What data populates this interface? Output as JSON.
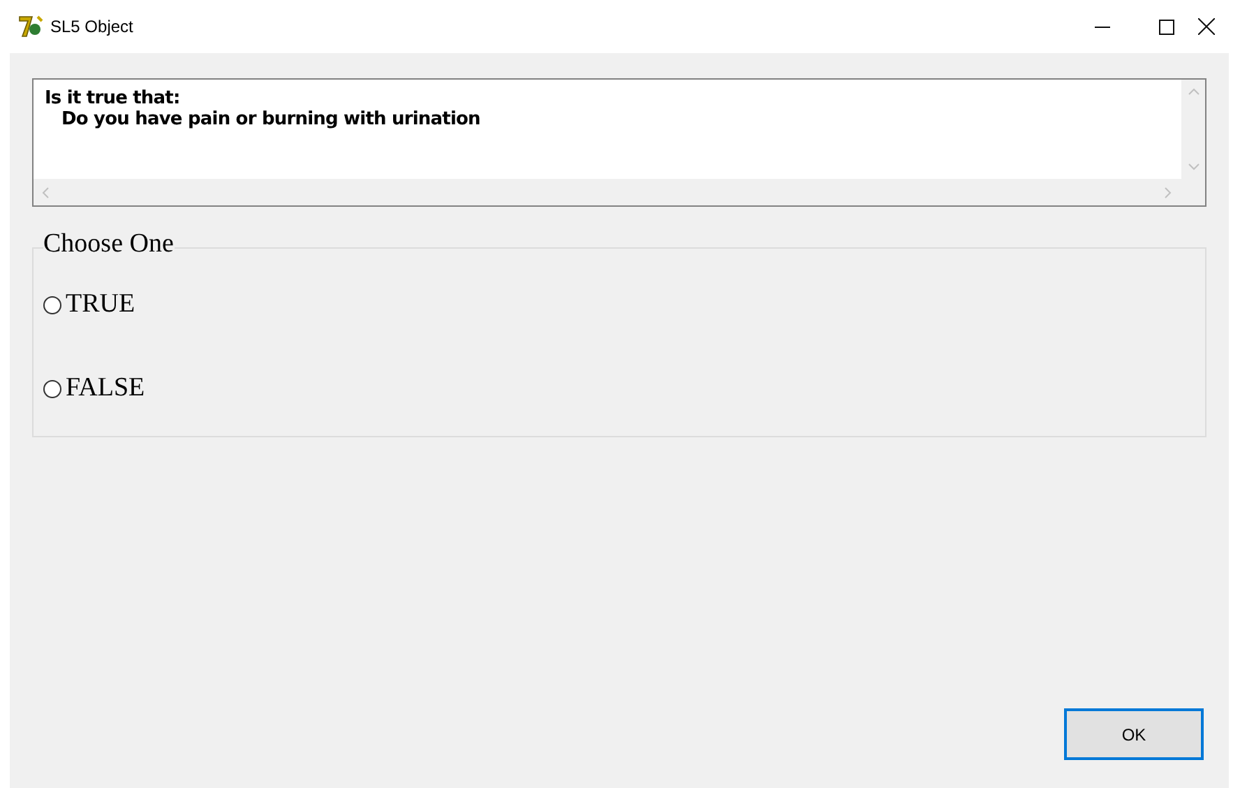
{
  "window": {
    "title": "SL5 Object"
  },
  "question": {
    "lines": [
      "Is it true that:",
      "Do you have pain or burning with urination"
    ]
  },
  "choices": {
    "title": "Choose One",
    "options": [
      {
        "label": "TRUE",
        "selected": false
      },
      {
        "label": "FALSE",
        "selected": false
      }
    ]
  },
  "buttons": [
    {
      "label": "OK",
      "default": true
    }
  ]
}
